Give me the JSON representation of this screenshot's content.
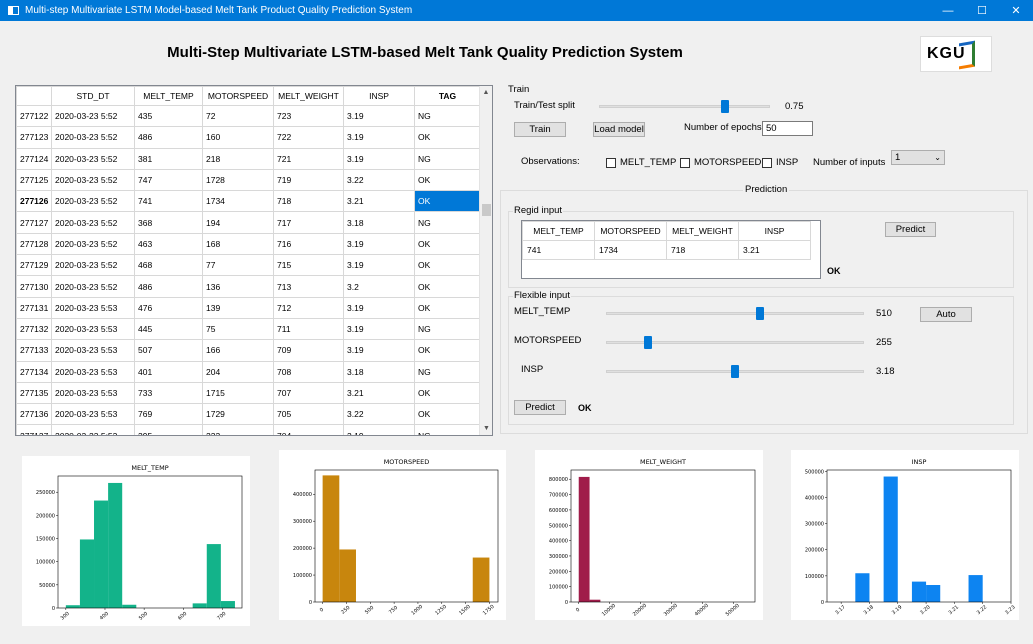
{
  "window": {
    "title": "Multi-step Multivariate LSTM Model-based Melt Tank Product Quality Prediction System",
    "min": "—",
    "max": "☐",
    "close": "✕"
  },
  "heading": "Multi-Step Multivariate LSTM-based Melt Tank Quality Prediction System",
  "logo": {
    "text": "KGU"
  },
  "grid": {
    "headers": [
      "",
      "STD_DT",
      "MELT_TEMP",
      "MOTORSPEED",
      "MELT_WEIGHT",
      "INSP",
      "TAG"
    ],
    "rows": [
      [
        "277122",
        "2020-03-23 5:52",
        "435",
        "72",
        "723",
        "3.19",
        "NG"
      ],
      [
        "277123",
        "2020-03-23 5:52",
        "486",
        "160",
        "722",
        "3.19",
        "OK"
      ],
      [
        "277124",
        "2020-03-23 5:52",
        "381",
        "218",
        "721",
        "3.19",
        "NG"
      ],
      [
        "277125",
        "2020-03-23 5:52",
        "747",
        "1728",
        "719",
        "3.22",
        "OK"
      ],
      [
        "277126",
        "2020-03-23 5:52",
        "741",
        "1734",
        "718",
        "3.21",
        "OK"
      ],
      [
        "277127",
        "2020-03-23 5:52",
        "368",
        "194",
        "717",
        "3.18",
        "NG"
      ],
      [
        "277128",
        "2020-03-23 5:52",
        "463",
        "168",
        "716",
        "3.19",
        "OK"
      ],
      [
        "277129",
        "2020-03-23 5:52",
        "468",
        "77",
        "715",
        "3.19",
        "OK"
      ],
      [
        "277130",
        "2020-03-23 5:52",
        "486",
        "136",
        "713",
        "3.2",
        "OK"
      ],
      [
        "277131",
        "2020-03-23 5:53",
        "476",
        "139",
        "712",
        "3.19",
        "OK"
      ],
      [
        "277132",
        "2020-03-23 5:53",
        "445",
        "75",
        "711",
        "3.19",
        "NG"
      ],
      [
        "277133",
        "2020-03-23 5:53",
        "507",
        "166",
        "709",
        "3.19",
        "OK"
      ],
      [
        "277134",
        "2020-03-23 5:53",
        "401",
        "204",
        "708",
        "3.18",
        "NG"
      ],
      [
        "277135",
        "2020-03-23 5:53",
        "733",
        "1715",
        "707",
        "3.21",
        "OK"
      ],
      [
        "277136",
        "2020-03-23 5:53",
        "769",
        "1729",
        "705",
        "3.22",
        "OK"
      ],
      [
        "277137",
        "2020-03-23 5:53",
        "395",
        "233",
        "704",
        "3.19",
        "NG"
      ]
    ],
    "current_row": 4,
    "selected_col": 6
  },
  "train": {
    "group_label": "Train",
    "split_label": "Train/Test split",
    "split_value": "0.75",
    "split_fraction": 0.75,
    "train_button": "Train",
    "load_button": "Load model",
    "epochs_label": "Number of epochs",
    "epochs_value": "50",
    "observations_label": "Observations:",
    "checks": [
      "MELT_TEMP",
      "MOTORSPEED",
      "INSP"
    ],
    "inputs_label": "Number of inputs",
    "inputs_value": "1"
  },
  "prediction": {
    "group_label": "Prediction",
    "regid_label": "Regid input",
    "regid_headers": [
      "MELT_TEMP",
      "MOTORSPEED",
      "MELT_WEIGHT",
      "INSP"
    ],
    "regid_values": [
      "741",
      "1734",
      "718",
      "3.21"
    ],
    "predict_button": "Predict",
    "regid_result": "OK",
    "flexible_label": "Flexible input",
    "sliders": [
      {
        "label": "MELT_TEMP",
        "value": "510",
        "fraction": 0.6
      },
      {
        "label": "MOTORSPEED",
        "value": "255",
        "fraction": 0.15
      },
      {
        "label": "INSP",
        "value": "3.18",
        "fraction": 0.5
      }
    ],
    "auto_button": "Auto",
    "predict2_button": "Predict",
    "flex_result": "OK"
  },
  "chart_data": [
    {
      "type": "bar",
      "title": "MELT_TEMP",
      "color": "#13b38a",
      "bins": [
        [
          300,
          336,
          6000
        ],
        [
          336,
          372,
          148000
        ],
        [
          372,
          408,
          232000
        ],
        [
          408,
          444,
          270000
        ],
        [
          444,
          480,
          7000
        ],
        [
          480,
          516,
          0
        ],
        [
          516,
          552,
          0
        ],
        [
          552,
          588,
          0
        ],
        [
          588,
          624,
          0
        ],
        [
          624,
          660,
          10000
        ],
        [
          660,
          696,
          138000
        ],
        [
          696,
          732,
          15000
        ]
      ],
      "xlim": [
        280,
        750
      ],
      "ylim": [
        0,
        285000
      ],
      "xticks": [
        "300",
        "400",
        "500",
        "600",
        "700",
        "800"
      ],
      "xtick_vals": [
        300,
        400,
        500,
        600,
        700,
        800
      ],
      "yticks": [
        "0",
        "50000",
        "100000",
        "150000",
        "200000",
        "250000"
      ],
      "ytick_vals": [
        0,
        50000,
        100000,
        150000,
        200000,
        250000
      ]
    },
    {
      "type": "bar",
      "title": "MOTORSPEED",
      "color": "#c8860d",
      "bins": [
        [
          0,
          175,
          470000
        ],
        [
          175,
          350,
          195000
        ],
        [
          350,
          525,
          0
        ],
        [
          525,
          700,
          0
        ],
        [
          700,
          875,
          0
        ],
        [
          875,
          1050,
          0
        ],
        [
          1050,
          1225,
          0
        ],
        [
          1225,
          1400,
          0
        ],
        [
          1400,
          1575,
          0
        ],
        [
          1575,
          1750,
          165000
        ]
      ],
      "xlim": [
        -80,
        1840
      ],
      "ylim": [
        0,
        490000
      ],
      "xticks": [
        "0",
        "250",
        "500",
        "750",
        "1000",
        "1250",
        "1500",
        "1750"
      ],
      "xtick_vals": [
        0,
        250,
        500,
        750,
        1000,
        1250,
        1500,
        1750
      ],
      "yticks": [
        "0",
        "100000",
        "200000",
        "300000",
        "400000"
      ],
      "ytick_vals": [
        0,
        100000,
        200000,
        300000,
        400000
      ]
    },
    {
      "type": "bar",
      "title": "MELT_WEIGHT",
      "color": "#a01c4a",
      "bins": [
        [
          0,
          3500,
          815000
        ],
        [
          3500,
          7000,
          15000
        ]
      ],
      "xlim": [
        -2500,
        57000
      ],
      "ylim": [
        0,
        860000
      ],
      "xticks": [
        "0",
        "10000",
        "20000",
        "30000",
        "40000",
        "50000"
      ],
      "xtick_vals": [
        0,
        10000,
        20000,
        30000,
        40000,
        50000
      ],
      "yticks": [
        "0",
        "100000",
        "200000",
        "300000",
        "400000",
        "500000",
        "600000",
        "700000",
        "800000"
      ],
      "ytick_vals": [
        0,
        100000,
        200000,
        300000,
        400000,
        500000,
        600000,
        700000,
        800000
      ]
    },
    {
      "type": "bar",
      "title": "INSP",
      "color": "#0d84f1",
      "bins": [
        [
          3.175,
          3.18,
          110000
        ],
        [
          3.185,
          3.19,
          480000
        ],
        [
          3.195,
          3.2,
          78000
        ],
        [
          3.2,
          3.205,
          65000
        ],
        [
          3.215,
          3.22,
          103000
        ]
      ],
      "xlim": [
        3.165,
        3.23
      ],
      "ylim": [
        0,
        505000
      ],
      "xticks": [
        "3.17",
        "3.18",
        "3.19",
        "3.20",
        "3.21",
        "3.22",
        "3.23"
      ],
      "xtick_vals": [
        3.17,
        3.18,
        3.19,
        3.2,
        3.21,
        3.22,
        3.23
      ],
      "yticks": [
        "0",
        "100000",
        "200000",
        "300000",
        "400000",
        "500000"
      ],
      "ytick_vals": [
        0,
        100000,
        200000,
        300000,
        400000,
        500000
      ]
    }
  ]
}
